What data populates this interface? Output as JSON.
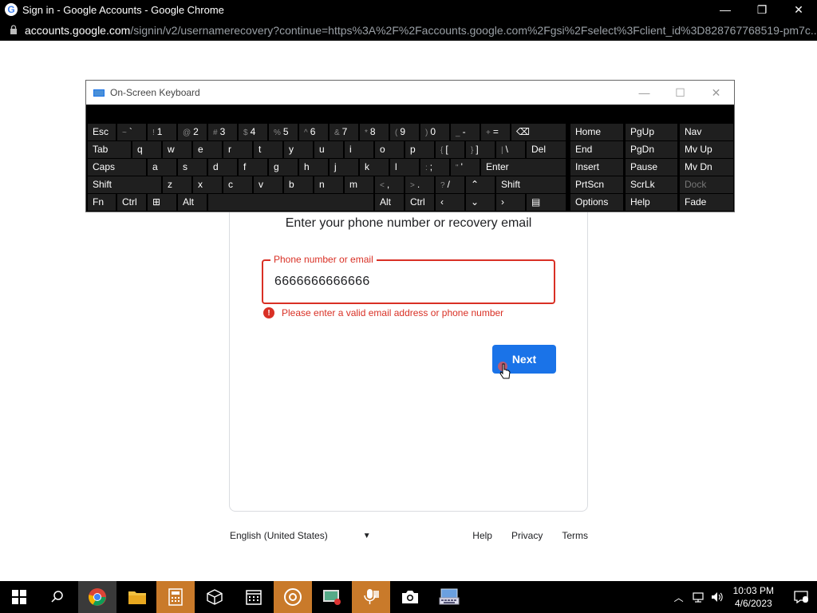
{
  "window": {
    "title": "Sign in - Google Accounts - Google Chrome",
    "minimize": "—",
    "restore": "❐",
    "close": "✕"
  },
  "address": {
    "host": "accounts.google.com",
    "path": "/signin/v2/usernamerecovery?continue=https%3A%2F%2Faccounts.google.com%2Fgsi%2Fselect%3Fclient_id%3D828767768519-pm7c..."
  },
  "osk": {
    "title": "On-Screen Keyboard",
    "rows": [
      [
        {
          "label": "Esc"
        },
        {
          "sub": "~",
          "label": "`"
        },
        {
          "sub": "!",
          "label": "1"
        },
        {
          "sub": "@",
          "label": "2"
        },
        {
          "sub": "#",
          "label": "3"
        },
        {
          "sub": "$",
          "label": "4"
        },
        {
          "sub": "%",
          "label": "5"
        },
        {
          "sub": "^",
          "label": "6"
        },
        {
          "sub": "&",
          "label": "7"
        },
        {
          "sub": "*",
          "label": "8"
        },
        {
          "sub": "(",
          "label": "9"
        },
        {
          "sub": ")",
          "label": "0"
        },
        {
          "sub": "_",
          "label": "-"
        },
        {
          "sub": "+",
          "label": "="
        },
        {
          "label": "⌫"
        }
      ],
      [
        {
          "label": "Tab"
        },
        {
          "label": "q"
        },
        {
          "label": "w"
        },
        {
          "label": "e"
        },
        {
          "label": "r"
        },
        {
          "label": "t"
        },
        {
          "label": "y"
        },
        {
          "label": "u"
        },
        {
          "label": "i"
        },
        {
          "label": "o"
        },
        {
          "label": "p"
        },
        {
          "sub": "{",
          "label": "["
        },
        {
          "sub": "}",
          "label": "]"
        },
        {
          "sub": "|",
          "label": "\\"
        },
        {
          "label": "Del"
        }
      ],
      [
        {
          "label": "Caps"
        },
        {
          "label": "a"
        },
        {
          "label": "s"
        },
        {
          "label": "d"
        },
        {
          "label": "f"
        },
        {
          "label": "g"
        },
        {
          "label": "h"
        },
        {
          "label": "j"
        },
        {
          "label": "k"
        },
        {
          "label": "l"
        },
        {
          "sub": ":",
          "label": ";"
        },
        {
          "sub": "\"",
          "label": "'"
        },
        {
          "label": "Enter"
        }
      ],
      [
        {
          "label": "Shift"
        },
        {
          "label": "z"
        },
        {
          "label": "x"
        },
        {
          "label": "c"
        },
        {
          "label": "v"
        },
        {
          "label": "b"
        },
        {
          "label": "n"
        },
        {
          "label": "m"
        },
        {
          "sub": "<",
          "label": ","
        },
        {
          "sub": ">",
          "label": "."
        },
        {
          "sub": "?",
          "label": "/"
        },
        {
          "label": "⌃"
        },
        {
          "label": "Shift"
        }
      ],
      [
        {
          "label": "Fn"
        },
        {
          "label": "Ctrl"
        },
        {
          "label": "⊞"
        },
        {
          "label": "Alt"
        },
        {
          "label": ""
        },
        {
          "label": "Alt"
        },
        {
          "label": "Ctrl"
        },
        {
          "label": "‹"
        },
        {
          "label": "⌄"
        },
        {
          "label": "›"
        },
        {
          "label": "▤"
        }
      ]
    ],
    "nav": [
      [
        "Home",
        "PgUp",
        "Nav"
      ],
      [
        "End",
        "PgDn",
        "Mv Up"
      ],
      [
        "Insert",
        "Pause",
        "Mv Dn"
      ],
      [
        "PrtScn",
        "ScrLk",
        "Dock"
      ],
      [
        "Options",
        "Help",
        "Fade"
      ]
    ]
  },
  "signin": {
    "heading": "Enter your phone number or recovery email",
    "field_label": "Phone number or email",
    "field_value": "6666666666666",
    "error": "Please enter a valid email address or phone number",
    "next": "Next"
  },
  "footer": {
    "language": "English (United States)",
    "links": [
      "Help",
      "Privacy",
      "Terms"
    ]
  },
  "taskbar": {
    "time": "10:03 PM",
    "date": "4/6/2023"
  }
}
